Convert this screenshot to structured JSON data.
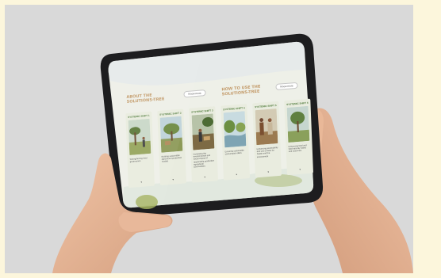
{
  "screen": {
    "about_title": "ABOUT THE SOLUTIONS-TREE",
    "howto_title": "HOW TO USE THE SOLUTIONS-TREE",
    "know_more_label": "Know more",
    "shifts": [
      {
        "title": "SYSTEMIC SHIFT 1",
        "description": "Strengthening food governance",
        "arrow": "▾"
      },
      {
        "title": "SYSTEMIC SHIFT 2",
        "description": "Building sustainable agricultural production models",
        "arrow": "▾"
      },
      {
        "title": "SYSTEMIC SHIFT 3",
        "description": "Increasing the environmental and social impact of responsible production agricultural commodities",
        "arrow": "▾"
      },
      {
        "title": "SYSTEMIC SHIFT 4",
        "description": "Ensuring sustainable consumption diets",
        "arrow": "▾"
      },
      {
        "title": "SYSTEMIC SHIFT 5",
        "description": "Enhancing accessibility and use of diets for health and the environment",
        "arrow": "▾"
      },
      {
        "title": "SYSTEMIC SHIFT 6",
        "description": "Enhancing food and food security habits and outcomes",
        "arrow": "▾"
      }
    ]
  },
  "colors": {
    "backdrop": "#d9d9d9",
    "page_border": "#fcf6dc",
    "tablet_bezel": "#1d1d1f",
    "screen_bg": "#eef0e8",
    "header_title": "#c39a69",
    "shift_title": "#4f7a3a",
    "card_bg": "#e9ecdf",
    "skin": "#e4b597"
  }
}
